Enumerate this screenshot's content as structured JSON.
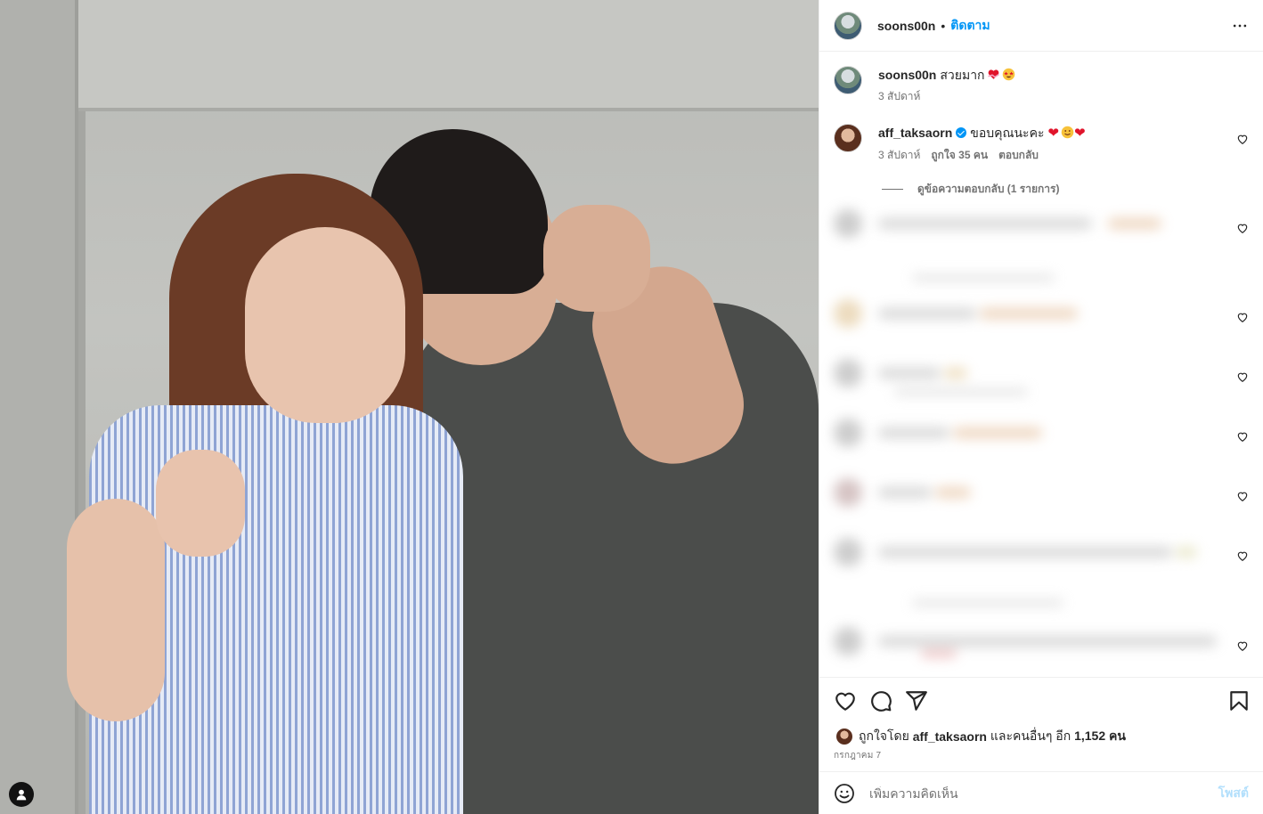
{
  "post": {
    "author": "soons00n",
    "separator": "•",
    "follow_label": "ติดตาม",
    "more_icon": "more-horizontal-icon"
  },
  "caption": {
    "username": "soons00n",
    "text": "สวยมาก",
    "emojis": [
      "heart-with-ribbon",
      "star-struck"
    ],
    "time": "3 สัปดาห์"
  },
  "comments": [
    {
      "username": "aff_taksaorn",
      "verified": true,
      "text": "ขอบคุณนะคะ",
      "emojis": [
        "red-heart",
        "smiling-face",
        "red-heart"
      ],
      "time": "3 สัปดาห์",
      "likes": "ถูกใจ 35 คน",
      "reply_label": "ตอบกลับ",
      "view_replies": "ดูข้อความตอบกลับ (1 รายการ)"
    }
  ],
  "likes": {
    "prefix": "ถูกใจโดย",
    "user": "aff_taksaorn",
    "middle": "และคนอื่นๆ อีก",
    "count": "1,152 คน"
  },
  "date": "กรกฎาคม 7",
  "composer": {
    "placeholder": "เพิ่มความคิดเห็น",
    "post_label": "โพสต์"
  },
  "colors": {
    "accent": "#0095f6",
    "post_disabled": "#b2dffc",
    "heart": "#e0142b",
    "muted": "#737373"
  }
}
